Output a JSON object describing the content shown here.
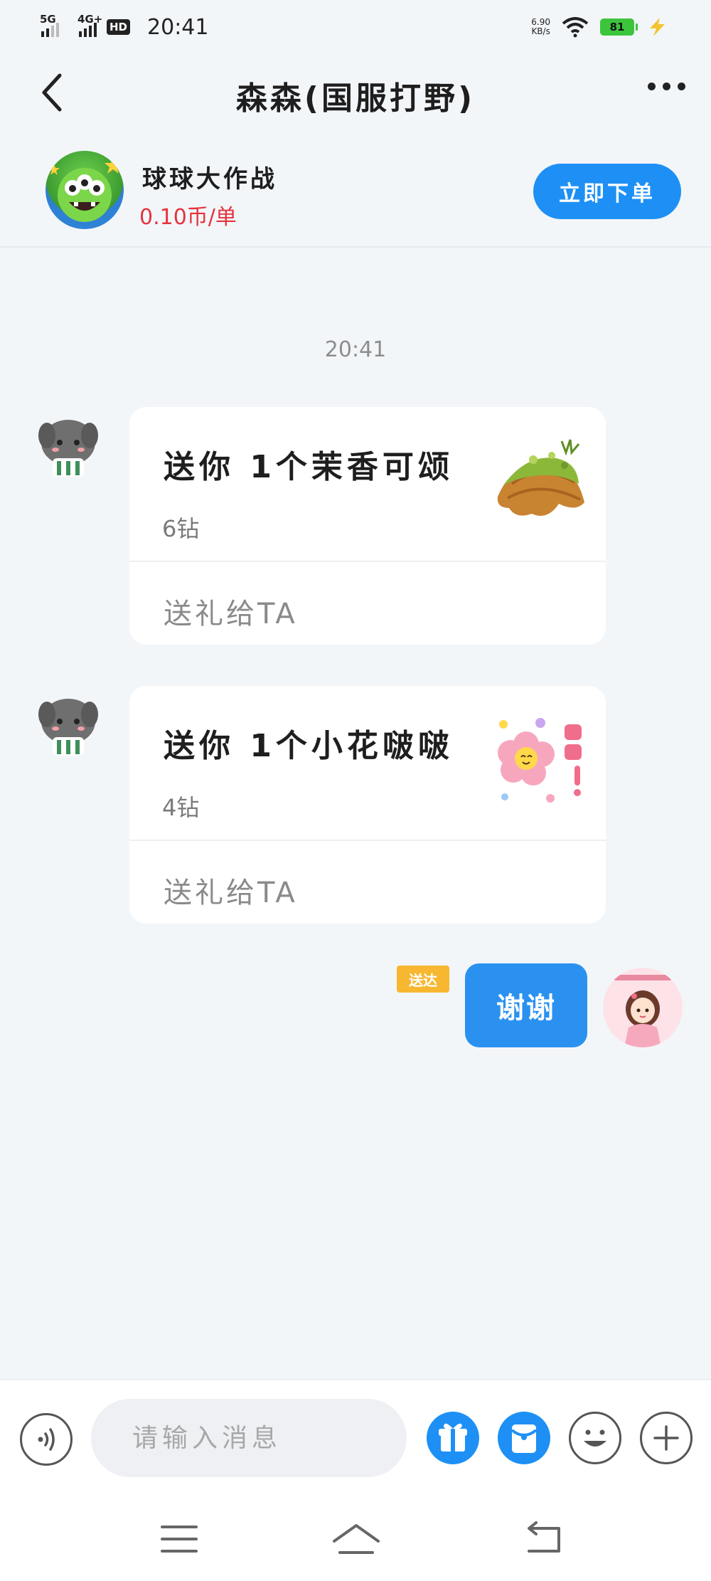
{
  "status_bar": {
    "net1": "5G",
    "net2": "4G+",
    "hd": "HD",
    "time": "20:41",
    "speed_value": "6.90",
    "speed_unit": "KB/s",
    "battery": "81"
  },
  "header": {
    "title": "森森(国服打野)"
  },
  "banner": {
    "game_name": "球球大作战",
    "price": "0.10币/单",
    "order_button": "立即下单"
  },
  "chat": {
    "timestamp": "20:41",
    "gifts": [
      {
        "title": "送你 1个茉香可颂",
        "cost": "6钻",
        "action": "送礼给TA"
      },
      {
        "title": "送你 1个小花啵啵",
        "cost": "4钻",
        "action": "送礼给TA"
      }
    ],
    "my_message": {
      "status": "送达",
      "text": "谢谢"
    }
  },
  "input_bar": {
    "placeholder": "请输入消息"
  },
  "colors": {
    "accent": "#1e90f5",
    "price_red": "#e5333d",
    "badge_yellow": "#f7b730",
    "background": "#f3f6f9"
  }
}
